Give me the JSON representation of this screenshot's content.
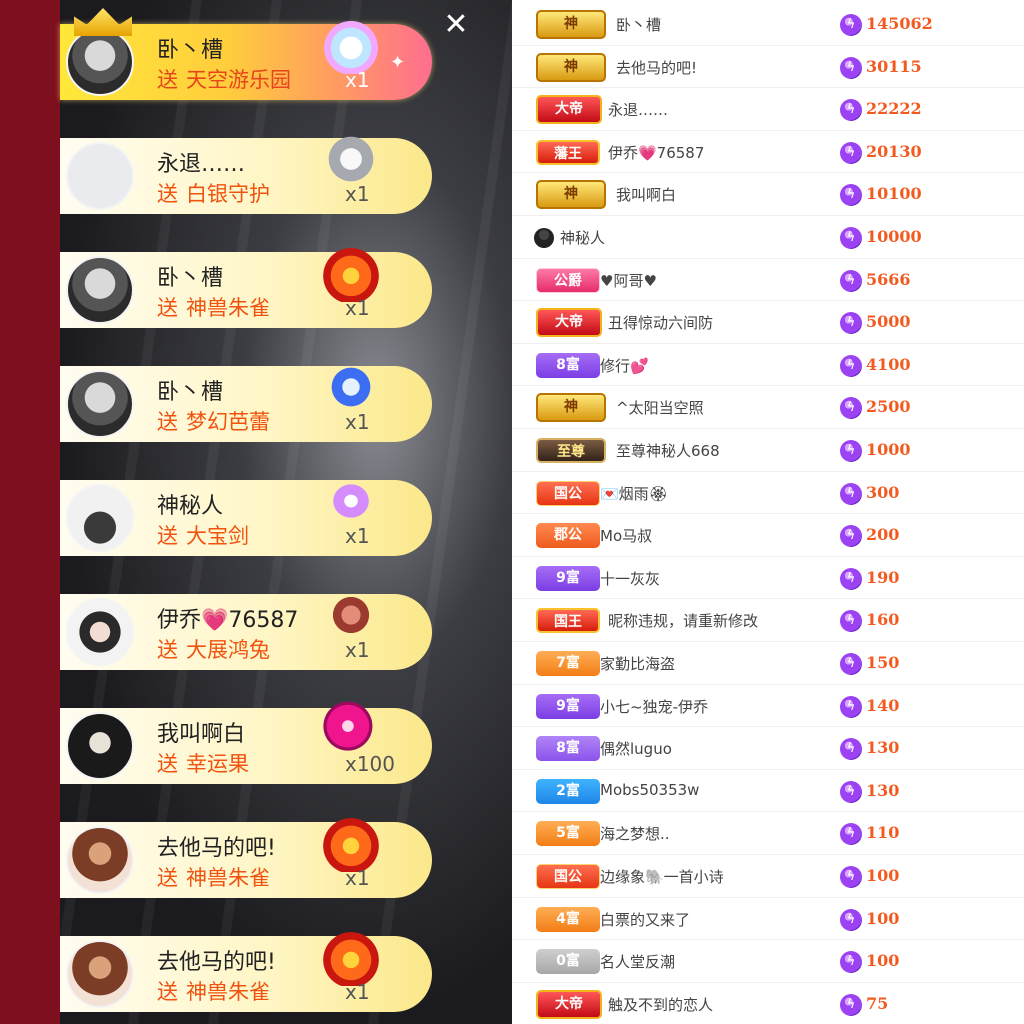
{
  "close_label": "✕",
  "gift_feed": [
    {
      "name": "卧丶槽",
      "send": "送",
      "gift": "天空游乐园",
      "count": "x1",
      "vip": true,
      "avatar": "dark",
      "gift_icon": "castle-icon"
    },
    {
      "name": "永退……",
      "send": "送",
      "gift": "白银守护",
      "count": "x1",
      "vip": false,
      "avatar": "blank",
      "gift_icon": "shield-icon"
    },
    {
      "name": "卧丶槽",
      "send": "送",
      "gift": "神兽朱雀",
      "count": "x1",
      "vip": false,
      "avatar": "dark",
      "gift_icon": "phoenix-icon"
    },
    {
      "name": "卧丶槽",
      "send": "送",
      "gift": "梦幻芭蕾",
      "count": "x1",
      "vip": false,
      "avatar": "dark",
      "gift_icon": "ballet-icon"
    },
    {
      "name": "神秘人",
      "send": "送",
      "gift": "大宝剑",
      "count": "x1",
      "vip": false,
      "avatar": "hat",
      "gift_icon": "sword-icon"
    },
    {
      "name": "伊乔💗76587",
      "send": "送",
      "gift": "大展鸿兔",
      "count": "x1",
      "vip": false,
      "avatar": "girl",
      "gift_icon": "rabbit-icon"
    },
    {
      "name": "我叫啊白",
      "send": "送",
      "gift": "幸运果",
      "count": "x100",
      "vip": false,
      "avatar": "mask",
      "gift_icon": "fruit-icon"
    },
    {
      "name": "去他马的吧!",
      "send": "送",
      "gift": "神兽朱雀",
      "count": "x1",
      "vip": false,
      "avatar": "toy",
      "gift_icon": "phoenix-icon"
    },
    {
      "name": "去他马的吧!",
      "send": "送",
      "gift": "神兽朱雀",
      "count": "x1",
      "vip": false,
      "avatar": "toy",
      "gift_icon": "phoenix-icon"
    }
  ],
  "ranking": [
    {
      "badge": "神",
      "badge_style": "b-god",
      "name": "卧丶槽",
      "score": "145062"
    },
    {
      "badge": "神",
      "badge_style": "b-god",
      "name": "去他马的吧!",
      "score": "30115"
    },
    {
      "badge": "大帝",
      "badge_style": "b-emperor",
      "name": "永退……",
      "score": "22222"
    },
    {
      "badge": "藩王",
      "badge_style": "b-king",
      "name": "伊乔💗76587",
      "score": "20130"
    },
    {
      "badge": "神",
      "badge_style": "b-god",
      "name": "我叫啊白",
      "score": "10100"
    },
    {
      "badge": "",
      "badge_style": "mystery",
      "name": "神秘人",
      "score": "10000"
    },
    {
      "badge": "公爵",
      "badge_style": "b-duke",
      "name": "♥阿哥♥",
      "score": "5666"
    },
    {
      "badge": "大帝",
      "badge_style": "b-emperor",
      "name": "丑得惊动六间防",
      "score": "5000"
    },
    {
      "badge": "8富",
      "badge_style": "b-rich-purple",
      "name": "修行💕",
      "score": "4100"
    },
    {
      "badge": "神",
      "badge_style": "b-god",
      "name": "^太阳当空照",
      "score": "2500"
    },
    {
      "badge": "至尊",
      "badge_style": "b-supreme",
      "name": "至尊神秘人668",
      "score": "1000"
    },
    {
      "badge": "国公",
      "badge_style": "b-state",
      "name": "💌烟雨🏵",
      "score": "300"
    },
    {
      "badge": "郡公",
      "badge_style": "b-county",
      "name": "Mo马叔",
      "score": "200"
    },
    {
      "badge": "9富",
      "badge_style": "b-rich-purple",
      "name": "十一灰灰",
      "score": "190"
    },
    {
      "badge": "国王",
      "badge_style": "b-king",
      "name": "昵称违规，请重新修改",
      "score": "160"
    },
    {
      "badge": "7富",
      "badge_style": "b-rich-orange",
      "name": "家勤比海盗",
      "score": "150"
    },
    {
      "badge": "9富",
      "badge_style": "b-rich-purple",
      "name": "小七~独宠-伊乔",
      "score": "140"
    },
    {
      "badge": "8富",
      "badge_style": "b-rich-lilac",
      "name": "偶然luguo",
      "score": "130"
    },
    {
      "badge": "2富",
      "badge_style": "b-rich-blue",
      "name": "Mobs50353w",
      "score": "130"
    },
    {
      "badge": "5富",
      "badge_style": "b-rich-orange",
      "name": "海之梦想..",
      "score": "110"
    },
    {
      "badge": "国公",
      "badge_style": "b-state",
      "name": "边缘象🐘一首小诗",
      "score": "100"
    },
    {
      "badge": "4富",
      "badge_style": "b-rich-orange",
      "name": "白票的又来了",
      "score": "100"
    },
    {
      "badge": "0富",
      "badge_style": "b-rich-gray",
      "name": "名人堂反潮",
      "score": "100"
    },
    {
      "badge": "大帝",
      "badge_style": "b-emperor",
      "name": "触及不到的恋人",
      "score": "75"
    }
  ]
}
